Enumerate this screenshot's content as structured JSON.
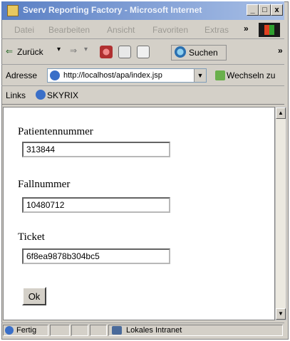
{
  "window": {
    "title": "Sverv Reporting Factory - Microsoft Internet",
    "minimize": "_",
    "maximize": "□",
    "close": "x"
  },
  "menu": {
    "items": [
      "Datei",
      "Bearbeiten",
      "Ansicht",
      "Favoriten",
      "Extras"
    ],
    "more": "»"
  },
  "toolbar": {
    "back_label": "Zurück",
    "search_label": "Suchen",
    "more": "»"
  },
  "address": {
    "label": "Adresse",
    "url": "http://localhost/apa/index.jsp",
    "go_label": "Wechseln zu"
  },
  "links": {
    "label": "Links",
    "item": "SKYRIX"
  },
  "form": {
    "patient_label": "Patientennummer",
    "patient_value": "313844",
    "case_label": "Fallnummer",
    "case_value": "10480712",
    "ticket_label": "Ticket",
    "ticket_value": "6f8ea9878b304bc5",
    "ok_label": "Ok"
  },
  "status": {
    "left": "Fertig",
    "zone": "Lokales Intranet"
  },
  "colors": {
    "titlebar": "#5a7fc4",
    "chrome": "#d4d0c8"
  }
}
